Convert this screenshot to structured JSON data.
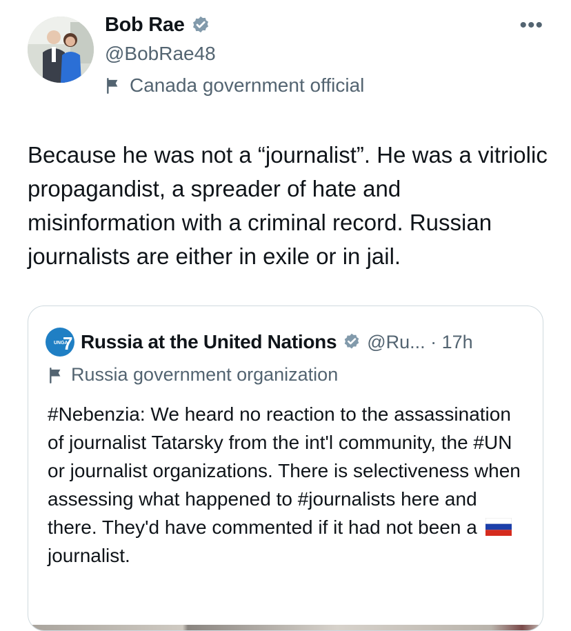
{
  "author": {
    "name": "Bob Rae",
    "handle": "@BobRae48",
    "affiliation": "Canada government official",
    "more_label": "•••"
  },
  "tweet": {
    "text": "Because he was not a “journalist”. He was a vitriolic propagandist, a spreader of hate and misinformation with a criminal record. Russian journalists are either in exile or in jail."
  },
  "quoted_tweet": {
    "name": "Russia at the United Nations",
    "handle": "@Ru... · 17h",
    "affiliation": "Russia government organization",
    "logo_text": "UNGA",
    "logo_number": "7",
    "text_before_flag": "#Nebenzia: We heard no reaction to the assassination of journalist Tatarsky from the int'l community, the #UN or journalist organizations. There is selectiveness when assessing what happened to #journalists here and there. They'd have commented if it had not been a",
    "text_after_flag": "journalist.",
    "flag": "russia-flag"
  },
  "colors": {
    "text": "#0f1419",
    "secondary": "#536471",
    "verified": "#829aab",
    "border": "#cfd9de"
  }
}
